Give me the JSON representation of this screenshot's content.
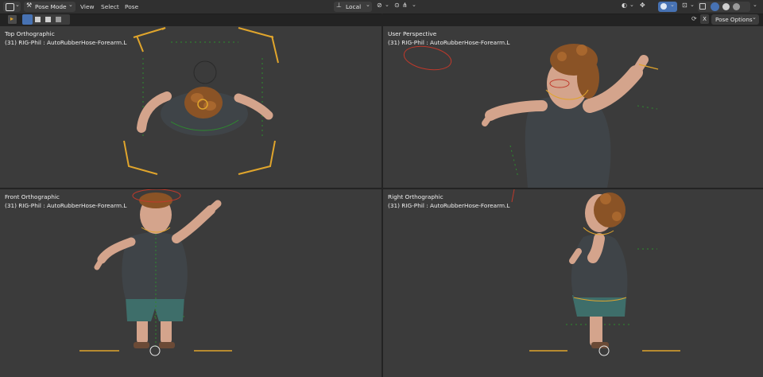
{
  "header": {
    "mode_label": "Pose Mode",
    "menu": [
      "View",
      "Select",
      "Pose"
    ],
    "transform_orientation": "Local",
    "pose_options_label": "Pose Options",
    "x_label": "X"
  },
  "viewports": [
    {
      "title": "Top Orthographic",
      "subtitle": "(31) RIG-Phil : AutoRubberHose-Forearm.L"
    },
    {
      "title": "User Perspective",
      "subtitle": "(31) RIG-Phil : AutoRubberHose-Forearm.L"
    },
    {
      "title": "Front Orthographic",
      "subtitle": "(31) RIG-Phil : AutoRubberHose-Forearm.L"
    },
    {
      "title": "Right Orthographic",
      "subtitle": "(31) RIG-Phil : AutoRubberHose-Forearm.L"
    }
  ],
  "colors": {
    "viewport_bg": "#3b3b3b",
    "header_bg": "#303030",
    "skin": "#d4a48c",
    "hair": "#8a5326",
    "shirt": "#3f4448",
    "shorts": "#3e6e6a",
    "bone_yellow": "#e0a52c",
    "bone_red": "#c0392b",
    "bone_green": "#2e8b2e",
    "accent_blue": "#4772b3"
  },
  "icons": [
    "editor-type-icon",
    "select-box-icon",
    "transform-orientation-icon",
    "pivot-icon",
    "snap-icon",
    "proportional-icon",
    "visibility-icon",
    "gizmo-icon",
    "overlay-icon",
    "xray-icon",
    "shading-wireframe-icon",
    "shading-solid-icon",
    "shading-material-icon",
    "shading-rendered-icon"
  ]
}
